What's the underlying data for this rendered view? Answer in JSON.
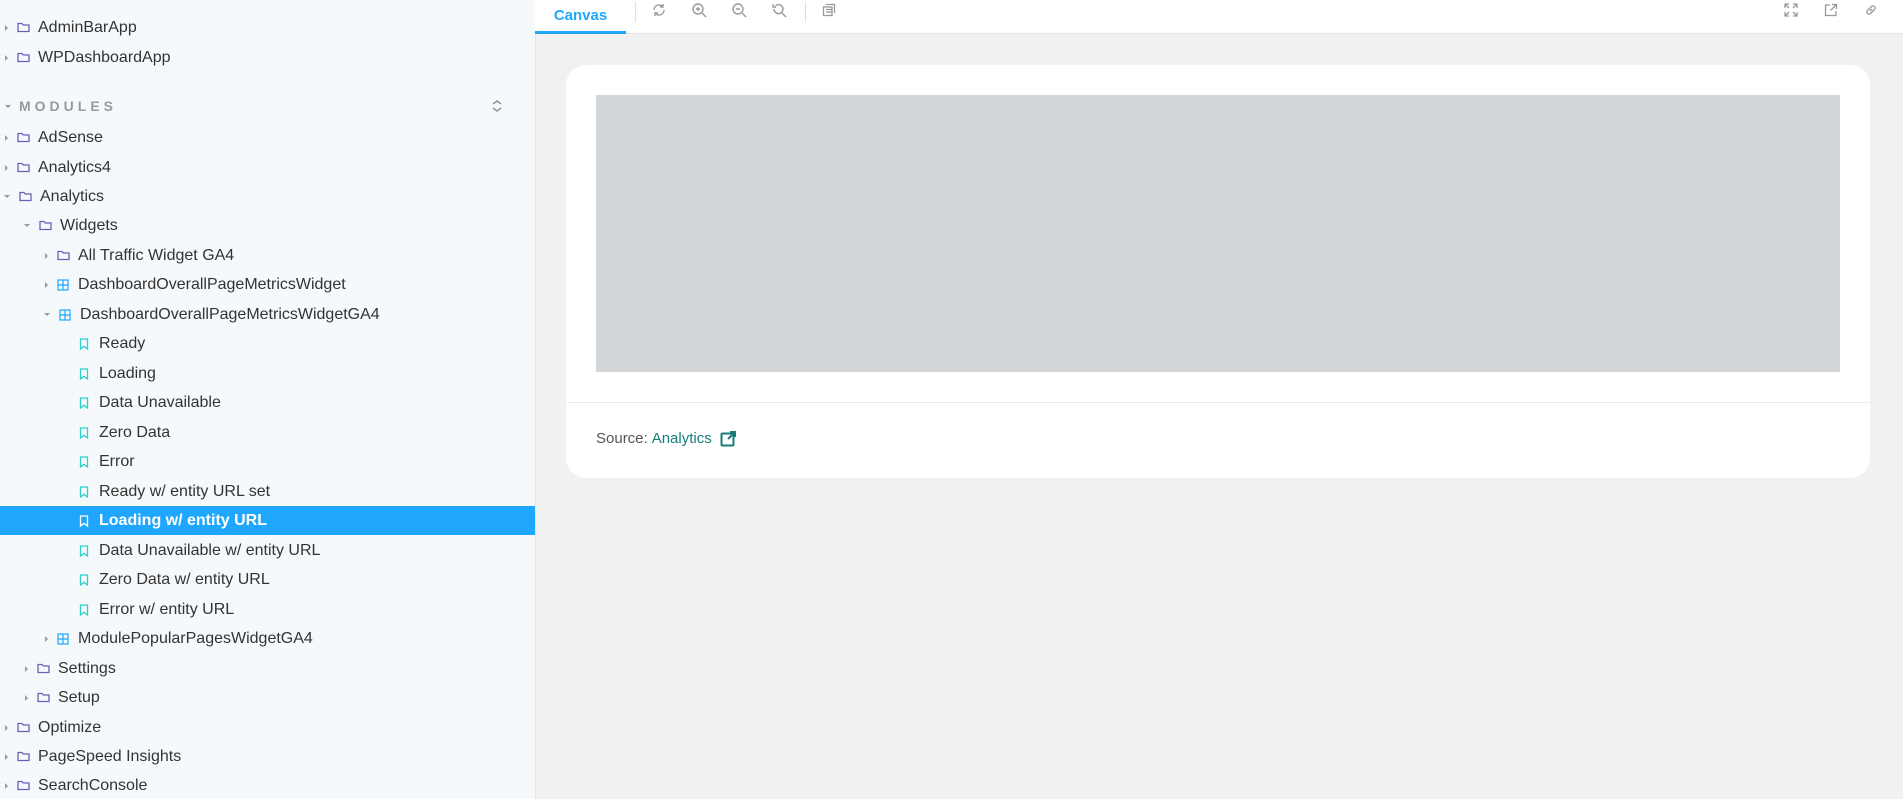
{
  "sidebar": {
    "views_items": [
      {
        "label": "AdminBarApp"
      },
      {
        "label": "WPDashboardApp"
      }
    ],
    "modules_section": {
      "label": "MODULES"
    },
    "tree": [
      {
        "label": "AdSense"
      },
      {
        "label": "Analytics4"
      },
      {
        "label": "Analytics"
      },
      {
        "label": "Widgets"
      },
      {
        "label": "All Traffic Widget GA4"
      },
      {
        "label": "DashboardOverallPageMetricsWidget"
      },
      {
        "label": "DashboardOverallPageMetricsWidgetGA4"
      },
      {
        "label": "Ready"
      },
      {
        "label": "Loading"
      },
      {
        "label": "Data Unavailable"
      },
      {
        "label": "Zero Data"
      },
      {
        "label": "Error"
      },
      {
        "label": "Ready w/ entity URL set"
      },
      {
        "label": "Loading w/ entity URL"
      },
      {
        "label": "Data Unavailable w/ entity URL"
      },
      {
        "label": "Zero Data w/ entity URL"
      },
      {
        "label": "Error w/ entity URL"
      },
      {
        "label": "ModulePopularPagesWidgetGA4"
      },
      {
        "label": "Settings"
      },
      {
        "label": "Setup"
      },
      {
        "label": "Optimize"
      },
      {
        "label": "PageSpeed Insights"
      },
      {
        "label": "SearchConsole"
      }
    ]
  },
  "toolbar": {
    "tab_canvas": "Canvas"
  },
  "card": {
    "source_label": "Source:",
    "source_link": "Analytics"
  },
  "colors": {
    "accent": "#1ea7fd",
    "folder_icon": "#6b5fb5",
    "component_icon": "#1ea7fd",
    "story_icon": "#2fd0c9",
    "link": "#167d7a",
    "placeholder": "#d2d6d9"
  }
}
